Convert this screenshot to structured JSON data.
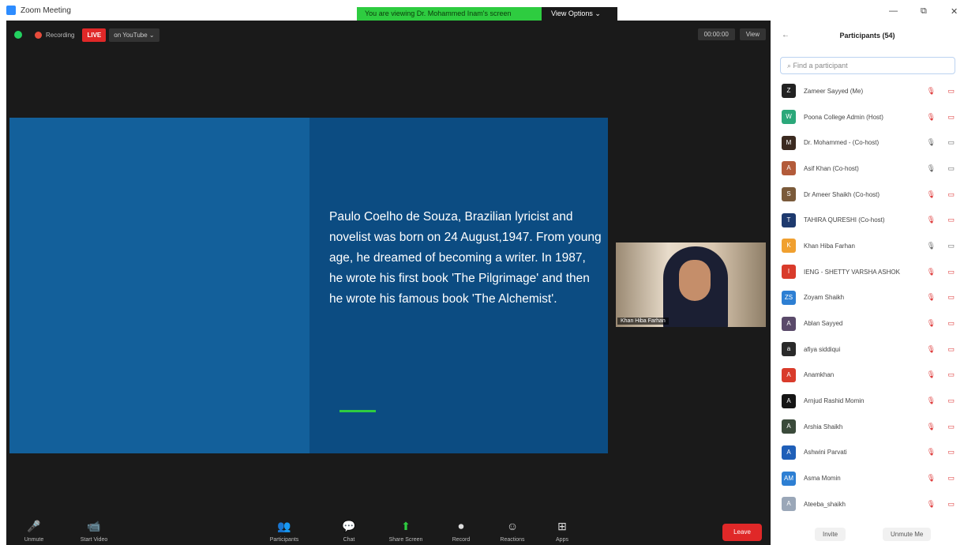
{
  "window": {
    "title": "Zoom Meeting"
  },
  "banner": {
    "viewing_text": "You are viewing Dr. Mohammed Inam's screen",
    "view_options": "View Options ⌄"
  },
  "topbar": {
    "recording_label": "Recording",
    "live_badge": "LIVE",
    "stream_label": "on YouTube ⌄",
    "right_items": [
      "00:00:00",
      "View"
    ]
  },
  "slide": {
    "text": "Paulo Coelho de Souza, Brazilian lyricist and novelist was born on 24 August,1947. From young age, he dreamed of becoming a writer. In 1987, he wrote his first book 'The Pilgrimage' and then he wrote his famous book 'The Alchemist'."
  },
  "speaker": {
    "name": "Khan Hiba Farhan"
  },
  "toolbar": {
    "items": [
      {
        "label": "Unmute",
        "icon": "🎤"
      },
      {
        "label": "Start Video",
        "icon": "📹"
      },
      {
        "label": "Participants",
        "icon": "👥"
      },
      {
        "label": "Chat",
        "icon": "💬"
      },
      {
        "label": "Share Screen",
        "icon": "⬆"
      },
      {
        "label": "Record",
        "icon": "⏺"
      },
      {
        "label": "Reactions",
        "icon": "☺"
      },
      {
        "label": "Apps",
        "icon": "⊞"
      }
    ],
    "leave_label": "Leave"
  },
  "panel": {
    "title": "Participants (54)",
    "search_placeholder": "Find a participant",
    "participants": [
      {
        "name": "Zameer Sayyed (Me)",
        "color": "#222222",
        "initials": "Z",
        "mic": "muted",
        "cam": "off"
      },
      {
        "name": "Poona College Admin (Host)",
        "color": "#2ba87a",
        "initials": "W",
        "mic": "muted",
        "cam": "off"
      },
      {
        "name": "Dr. Mohammed - (Co-host)",
        "color": "#3b2a20",
        "initials": "M",
        "mic": "on",
        "cam": "on"
      },
      {
        "name": "Asif Khan (Co-host)",
        "color": "#b35b3a",
        "initials": "A",
        "mic": "on",
        "cam": "on"
      },
      {
        "name": "Dr Ameer Shaikh (Co-host)",
        "color": "#7a5a3a",
        "initials": "S",
        "mic": "muted",
        "cam": "off"
      },
      {
        "name": "TAHIRA QURESHI (Co-host)",
        "color": "#1e3a6e",
        "initials": "T",
        "mic": "muted",
        "cam": "off"
      },
      {
        "name": "Khan Hiba Farhan",
        "color": "#f0a030",
        "initials": "K",
        "mic": "on",
        "cam": "on"
      },
      {
        "name": "IENG - SHETTY VARSHA ASHOK",
        "color": "#d93b2b",
        "initials": "I",
        "mic": "muted",
        "cam": "off"
      },
      {
        "name": "Zoyam Shaikh",
        "color": "#2d7fd3",
        "initials": "ZS",
        "mic": "muted",
        "cam": "off"
      },
      {
        "name": "Ablan Sayyed",
        "color": "#5a4a6a",
        "initials": "A",
        "mic": "muted",
        "cam": "off"
      },
      {
        "name": "afiya siddiqui",
        "color": "#2a2a2a",
        "initials": "a",
        "mic": "muted",
        "cam": "off"
      },
      {
        "name": "Anamkhan",
        "color": "#d93b2b",
        "initials": "A",
        "mic": "muted",
        "cam": "off"
      },
      {
        "name": "Arnjud Rashid Momin",
        "color": "#151515",
        "initials": "A",
        "mic": "muted",
        "cam": "off"
      },
      {
        "name": "Arshia Shaikh",
        "color": "#3a4a3a",
        "initials": "A",
        "mic": "muted",
        "cam": "off"
      },
      {
        "name": "Ashwini Parvati",
        "color": "#1f5fb8",
        "initials": "A",
        "mic": "muted",
        "cam": "off"
      },
      {
        "name": "Asma Momin",
        "color": "#2d7fd3",
        "initials": "AM",
        "mic": "muted",
        "cam": "off"
      },
      {
        "name": "Ateeba_shaikh",
        "color": "#9aa7b8",
        "initials": "A",
        "mic": "muted",
        "cam": "off"
      }
    ],
    "invite_label": "Invite",
    "unmute_me_label": "Unmute Me"
  },
  "colors": {
    "slide_dark": "#0c4c82",
    "slide_light": "#13609b",
    "accent_green": "#2ecc40",
    "leave_red": "#e02828"
  }
}
